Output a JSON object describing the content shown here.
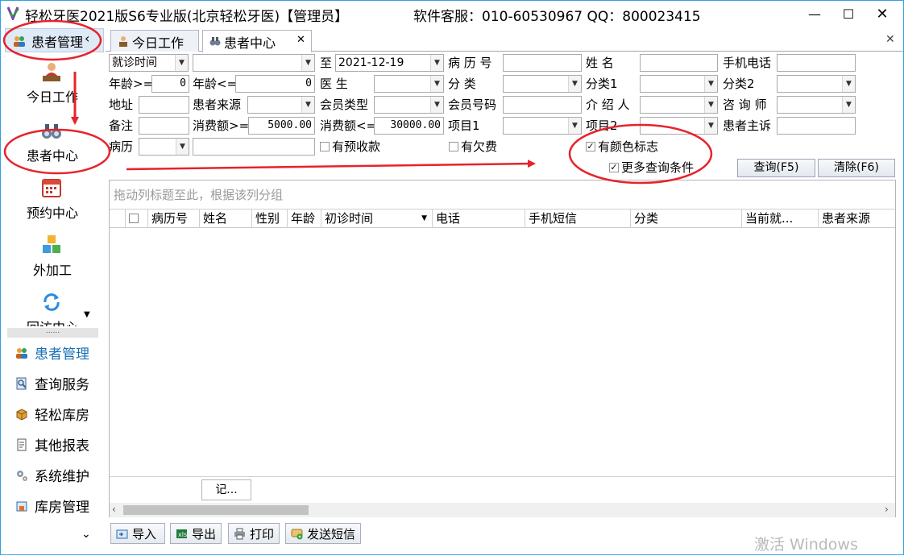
{
  "window": {
    "title": "轻松牙医2021版S6专业版(北京轻松牙医)【管理员】",
    "support": "软件客服：010-60530967  QQ：800023415",
    "min_glyph": "—",
    "max_glyph": "☐",
    "close_glyph": "✕"
  },
  "nav": {
    "header": {
      "title": "患者管理",
      "collapse_glyph": "‹"
    },
    "big_items": [
      {
        "label": "今日工作",
        "icon": "desk-person-icon"
      },
      {
        "label": "患者中心",
        "icon": "binoculars-icon"
      },
      {
        "label": "预约中心",
        "icon": "calendar-icon"
      },
      {
        "label": "外加工",
        "icon": "cubes-icon"
      },
      {
        "label": "回访中心",
        "icon": "refresh-icon"
      }
    ],
    "splitter_glyph": "......",
    "small_items": [
      {
        "label": "患者管理",
        "icon": "people-icon",
        "active": true
      },
      {
        "label": "查询服务",
        "icon": "search-doc-icon"
      },
      {
        "label": "轻松库房",
        "icon": "box-icon"
      },
      {
        "label": "其他报表",
        "icon": "report-icon"
      },
      {
        "label": "系统维护",
        "icon": "gears-icon"
      },
      {
        "label": "库房管理",
        "icon": "warehouse-icon"
      }
    ],
    "more_glyph": "⌄"
  },
  "tabs": [
    {
      "label": "今日工作",
      "icon": "desk-person-icon"
    },
    {
      "label": "患者中心",
      "icon": "binoculars-icon",
      "close_glyph": "✕"
    }
  ],
  "panel_close_glyph": "✕",
  "form": {
    "visit_time_select": "就诊时间",
    "date_from": "",
    "to_label": "至",
    "date_to": "2021-12-19",
    "record_no_label": "病 历 号",
    "name_label": "姓    名",
    "mobile_label": "手机电话",
    "age_ge_label": "年龄>=",
    "age_ge_value": "0",
    "age_le_label": "年龄<=",
    "age_le_value": "0",
    "doctor_label": "医    生",
    "category_label": "分    类",
    "category1_label": "分类1",
    "category2_label": "分类2",
    "address_label": "地址",
    "patient_source_label": "患者来源",
    "member_type_label": "会员类型",
    "member_no_label": "会员号码",
    "referrer_label": "介 绍 人",
    "consultant_label": "咨 询 师",
    "remark_label": "备注",
    "spend_ge_label": "消费额>=",
    "spend_ge_value": "5000.00",
    "spend_le_label": "消费额<=",
    "spend_le_value": "30000.00",
    "item1_label": "项目1",
    "item2_label": "项目2",
    "complaint_label": "患者主诉",
    "medical_record_label": "病历",
    "prepaid_label": "有预收款",
    "arrears_label": "有欠费",
    "color_mark_label": "有颜色标志",
    "more_conditions_label": "更多查询条件",
    "check_glyph": "✓",
    "dropdown_glyph": "▼",
    "query_button": "查询(F5)",
    "clear_button": "清除(F6)"
  },
  "grid": {
    "group_hint": "拖动列标题至此，根据该列分组",
    "columns": [
      "",
      "",
      "病历号",
      "姓名",
      "性别",
      "年龄",
      "初诊时间",
      "电话",
      "手机短信",
      "分类",
      "当前就...",
      "患者来源"
    ],
    "sort_glyph": "▼",
    "footer_cell": "记...",
    "scroll_left": "‹",
    "scroll_right": "›"
  },
  "toolbar": {
    "import": "导入",
    "export": "导出",
    "print": "打印",
    "sms": "发送短信"
  },
  "watermark": "激活 Windows",
  "colors": {
    "accent": "#33a0e0",
    "annotation": "#e8222b",
    "nav_active": "#1a6fb5"
  }
}
